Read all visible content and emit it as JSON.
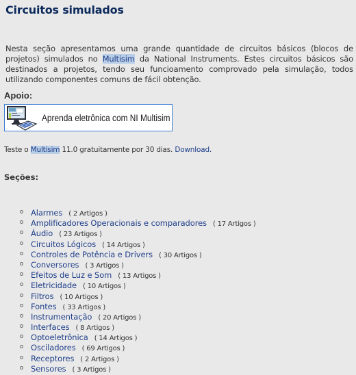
{
  "page": {
    "title": "Circuitos simulados"
  },
  "intro": {
    "before": "Nesta seção apresentamos uma grande quantidade de circuitos básicos (blocos de projetos) simulados no ",
    "highlight": "Multisim",
    "after": " da National Instruments. Estes circuitos básicos são destinados a projetos, tendo seu funcioamento comprovado pela simulação, todos utilizando componentes comuns de fácil obtenção."
  },
  "apoio": {
    "label": "Apoio:",
    "banner_text": "Aprenda eletrônica com NI Multisim",
    "banner_icon": "computer-and-breadboard-icon",
    "banner_border_color": "#3a7ad1"
  },
  "trial": {
    "before": "Teste o ",
    "highlight": "Multisim",
    "after": " 11.0 gratuitamente por 30 dias.  ",
    "download_label": "Download."
  },
  "sections": {
    "label": "Seções:",
    "items": [
      {
        "name": "Alarmes",
        "count": "( 2 Artigos )"
      },
      {
        "name": "Amplificadores Operacionais e comparadores",
        "count": "( 17 Artigos )"
      },
      {
        "name": "Áudio",
        "count": "( 23 Artigos )"
      },
      {
        "name": "Circuitos Lógicos",
        "count": "( 14 Artigos )"
      },
      {
        "name": "Controles de Potência e Drivers",
        "count": "( 30 Artigos )"
      },
      {
        "name": "Conversores",
        "count": "( 3 Artigos )"
      },
      {
        "name": "Efeitos de Luz e Som",
        "count": "( 13 Artigos )"
      },
      {
        "name": "Eletricidade",
        "count": "( 10 Artigos )"
      },
      {
        "name": "Filtros",
        "count": "( 10 Artigos )"
      },
      {
        "name": "Fontes",
        "count": "( 33 Artigos )"
      },
      {
        "name": "Instrumentação",
        "count": "( 20 Artigos )"
      },
      {
        "name": "Interfaces",
        "count": "( 8 Artigos )"
      },
      {
        "name": "Optoeletrônica",
        "count": "( 14 Artigos )"
      },
      {
        "name": "Osciladores",
        "count": "( 69 Artigos )"
      },
      {
        "name": "Receptores",
        "count": "( 2 Artigos )"
      },
      {
        "name": "Sensores",
        "count": "( 3 Artigos )"
      }
    ]
  },
  "colors": {
    "title": "#0c2a5c",
    "link": "#1f3f8a",
    "highlight_bg": "#b8cde6",
    "background": "#e9e9e9"
  }
}
